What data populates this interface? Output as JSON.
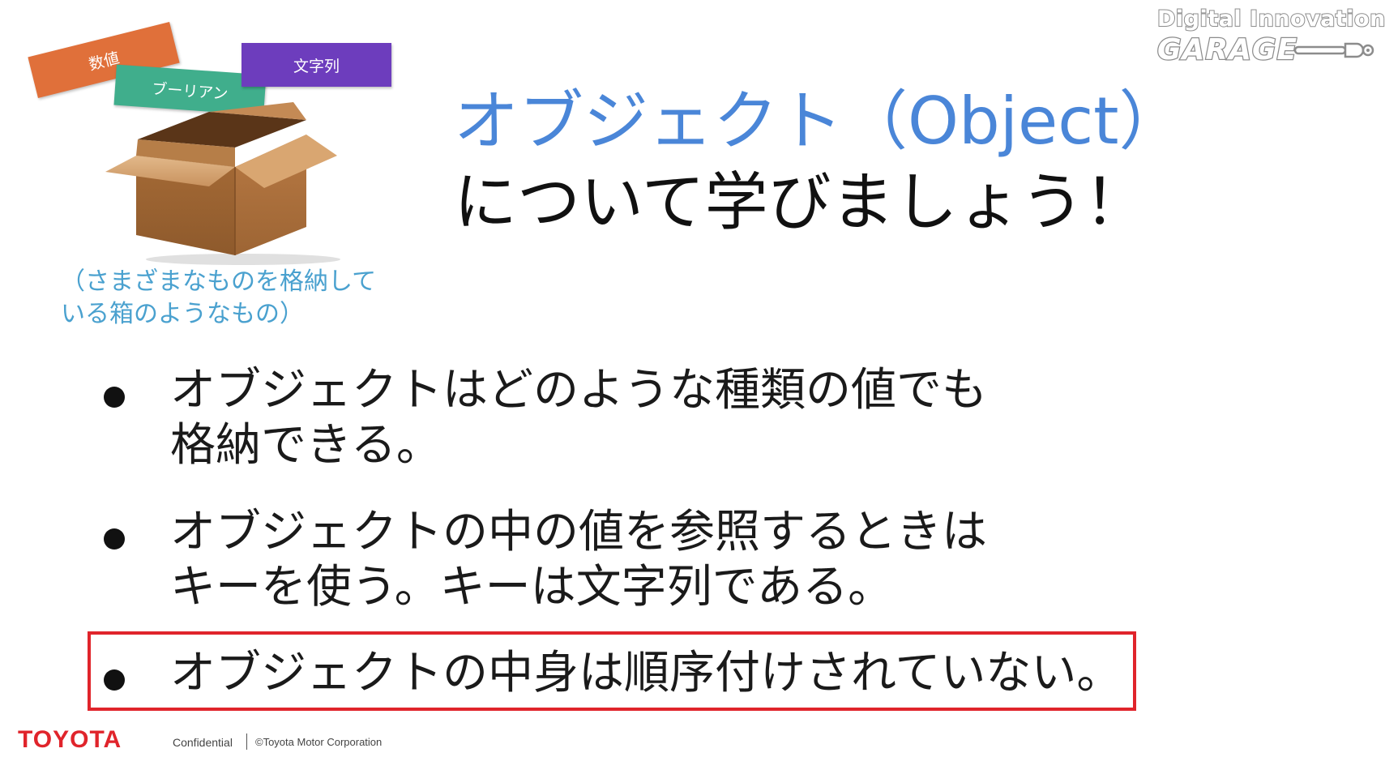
{
  "logo": {
    "line1": "Digital Innovation",
    "line2": "GARAGE",
    "icon": "wrench-icon"
  },
  "illustration": {
    "tags": {
      "number": "数値",
      "boolean": "ブーリアン",
      "string": "文字列"
    },
    "caption_line1": "（さまざまなものを格納して",
    "caption_line2": "いる箱のようなもの）"
  },
  "title": {
    "line1": "オブジェクト（Object）",
    "line2": "について学びましょう！"
  },
  "bullets": [
    {
      "line1": "オブジェクトはどのような種類の値でも",
      "line2": "格納できる。"
    },
    {
      "line1": "オブジェクトの中の値を参照するときは",
      "line2": "キーを使う。キーは文字列である。"
    },
    {
      "line1": "オブジェクトの中身は順序付けされていない。"
    }
  ],
  "footer": {
    "brand": "TOYOTA",
    "confidential": "Confidential",
    "copyright": "©Toyota Motor Corporation"
  },
  "colors": {
    "title_accent": "#4a86d8",
    "caption": "#4aa1cf",
    "highlight_border": "#e0242b",
    "brand_red": "#e0242b",
    "tag_number": "#e0703a",
    "tag_boolean": "#40ae8c",
    "tag_string": "#6d3dbd",
    "box_brown": "#a86c3c"
  }
}
